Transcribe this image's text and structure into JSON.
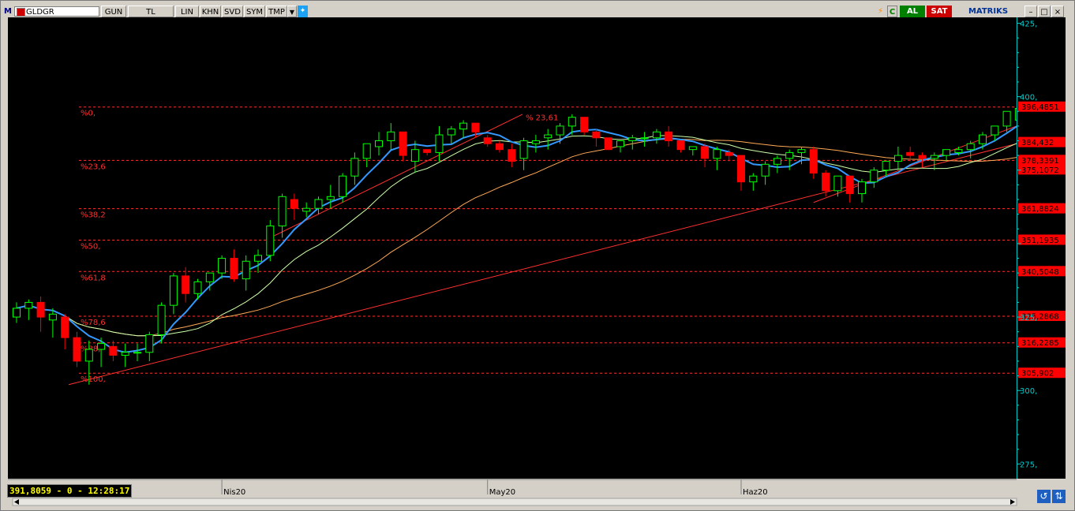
{
  "toolbar": {
    "logo": "M",
    "symbol": "GLDGR",
    "buttons": [
      "GUN",
      "TL",
      "LIN",
      "KHN",
      "SVD",
      "SYM",
      "TMP"
    ],
    "al_label": "AL",
    "sat_label": "SAT",
    "brand": "MATRIKS"
  },
  "status": {
    "readout": "391,8059 - 0 - 12:28:17"
  },
  "colors": {
    "up": "#00ff00",
    "down": "#ff0000",
    "ma_blue": "#3399ff",
    "ma_green": "#ccffaa",
    "ma_orange": "#ffaa55",
    "fib": "#ff3030",
    "axis": "#00cccc"
  },
  "chart_data": {
    "type": "candlestick",
    "ylim": [
      270,
      427
    ],
    "y_ticks": [
      {
        "value": 425,
        "label": "425,"
      },
      {
        "value": 400,
        "label": "400,"
      },
      {
        "value": 325,
        "label": "325,"
      },
      {
        "value": 300,
        "label": "300,"
      },
      {
        "value": 275,
        "label": "275,"
      }
    ],
    "x_labels": [
      {
        "index": 17,
        "label": "Nis20"
      },
      {
        "index": 39,
        "label": "May20"
      },
      {
        "index": 60,
        "label": "Haz20"
      }
    ],
    "candles": [
      [
        325,
        330,
        323,
        328
      ],
      [
        328,
        331,
        324,
        330
      ],
      [
        330,
        332,
        320,
        325
      ],
      [
        324,
        328,
        318,
        326
      ],
      [
        325,
        326,
        314,
        318
      ],
      [
        318,
        320,
        308,
        310
      ],
      [
        310,
        317,
        302,
        314
      ],
      [
        314,
        318,
        308,
        316
      ],
      [
        315,
        317,
        310,
        312
      ],
      [
        312,
        316,
        308,
        313
      ],
      [
        313,
        316,
        310,
        313
      ],
      [
        313,
        320,
        310,
        319
      ],
      [
        319,
        330,
        316,
        329
      ],
      [
        329,
        340,
        326,
        339
      ],
      [
        339,
        342,
        330,
        333
      ],
      [
        333,
        338,
        331,
        337
      ],
      [
        337,
        340,
        334,
        340
      ],
      [
        340,
        346,
        338,
        345
      ],
      [
        345,
        348,
        337,
        338
      ],
      [
        338,
        346,
        334,
        344
      ],
      [
        344,
        348,
        340,
        346
      ],
      [
        346,
        358,
        344,
        356
      ],
      [
        356,
        367,
        352,
        366
      ],
      [
        365,
        367,
        358,
        362
      ],
      [
        361,
        364,
        359,
        362
      ],
      [
        362,
        366,
        360,
        365
      ],
      [
        365,
        370,
        362,
        366
      ],
      [
        366,
        374,
        364,
        373
      ],
      [
        373,
        381,
        370,
        379
      ],
      [
        379,
        384,
        376,
        384
      ],
      [
        383,
        388,
        380,
        385
      ],
      [
        385,
        391,
        382,
        388
      ],
      [
        388,
        384,
        378,
        380
      ],
      [
        378,
        385,
        374,
        382
      ],
      [
        382,
        382,
        380,
        381
      ],
      [
        381,
        390,
        378,
        387
      ],
      [
        387,
        390,
        384,
        389
      ],
      [
        389,
        392,
        386,
        391
      ],
      [
        391,
        389,
        386,
        388
      ],
      [
        386,
        387,
        383,
        384
      ],
      [
        384,
        385,
        381,
        382
      ],
      [
        382,
        384,
        376,
        378
      ],
      [
        379,
        386,
        375,
        385
      ],
      [
        384,
        387,
        381,
        385
      ],
      [
        386,
        389,
        382,
        387
      ],
      [
        387,
        391,
        384,
        390
      ],
      [
        390,
        394,
        387,
        393
      ],
      [
        393,
        393,
        387,
        388
      ],
      [
        388,
        389,
        383,
        386
      ],
      [
        386,
        386,
        382,
        382
      ],
      [
        383,
        385,
        381,
        385
      ],
      [
        385,
        387,
        382,
        386
      ],
      [
        386,
        388,
        383,
        386
      ],
      [
        386,
        389,
        384,
        388
      ],
      [
        388,
        390,
        383,
        385
      ],
      [
        385,
        385,
        381,
        382
      ],
      [
        382,
        383,
        380,
        383
      ],
      [
        383,
        384,
        376,
        379
      ],
      [
        379,
        383,
        375,
        382
      ],
      [
        381,
        382,
        378,
        380
      ],
      [
        380,
        380,
        368,
        371
      ],
      [
        371,
        374,
        368,
        373
      ],
      [
        373,
        378,
        370,
        377
      ],
      [
        377,
        380,
        374,
        379
      ],
      [
        379,
        382,
        375,
        381
      ],
      [
        381,
        383,
        377,
        382
      ],
      [
        382,
        383,
        372,
        374
      ],
      [
        374,
        375,
        366,
        368
      ],
      [
        368,
        373,
        366,
        373
      ],
      [
        373,
        373,
        364,
        367
      ],
      [
        367,
        372,
        364,
        371
      ],
      [
        371,
        376,
        369,
        375
      ],
      [
        375,
        378,
        373,
        378
      ],
      [
        378,
        383,
        375,
        380
      ],
      [
        381,
        383,
        378,
        380
      ],
      [
        380,
        381,
        376,
        379
      ],
      [
        379,
        381,
        375,
        380
      ],
      [
        380,
        382,
        378,
        382
      ],
      [
        381,
        383,
        380,
        382
      ],
      [
        382,
        385,
        379,
        384
      ],
      [
        384,
        388,
        382,
        387
      ],
      [
        387,
        390,
        385,
        390
      ],
      [
        390,
        393,
        388,
        395
      ],
      [
        392,
        396,
        392,
        396
      ]
    ],
    "fib_levels": [
      {
        "label": "%0,",
        "value": 396.4851,
        "tag": "396,4851"
      },
      {
        "label": "%23,6",
        "value": 378.3391,
        "tag": "378,3391"
      },
      {
        "label": "%38,2",
        "value": 361.8824,
        "tag": "361,8824"
      },
      {
        "label": "%50,",
        "value": 351.1935,
        "tag": "351,1935"
      },
      {
        "label": "%61,8",
        "value": 340.5048,
        "tag": "340,5048"
      },
      {
        "label": "%78,6",
        "value": 325.2868,
        "tag": "325,2868"
      },
      {
        "label": "%88,",
        "value": 316.2285,
        "tag": "316,2285"
      },
      {
        "label": "%100,",
        "value": 305.902,
        "tag": "305,902"
      }
    ],
    "price_tags": [
      {
        "value": 384.432,
        "tag": "384,432"
      },
      {
        "value": 375.1072,
        "tag": "375,1072"
      }
    ],
    "top_annotation": "% 23,61"
  }
}
